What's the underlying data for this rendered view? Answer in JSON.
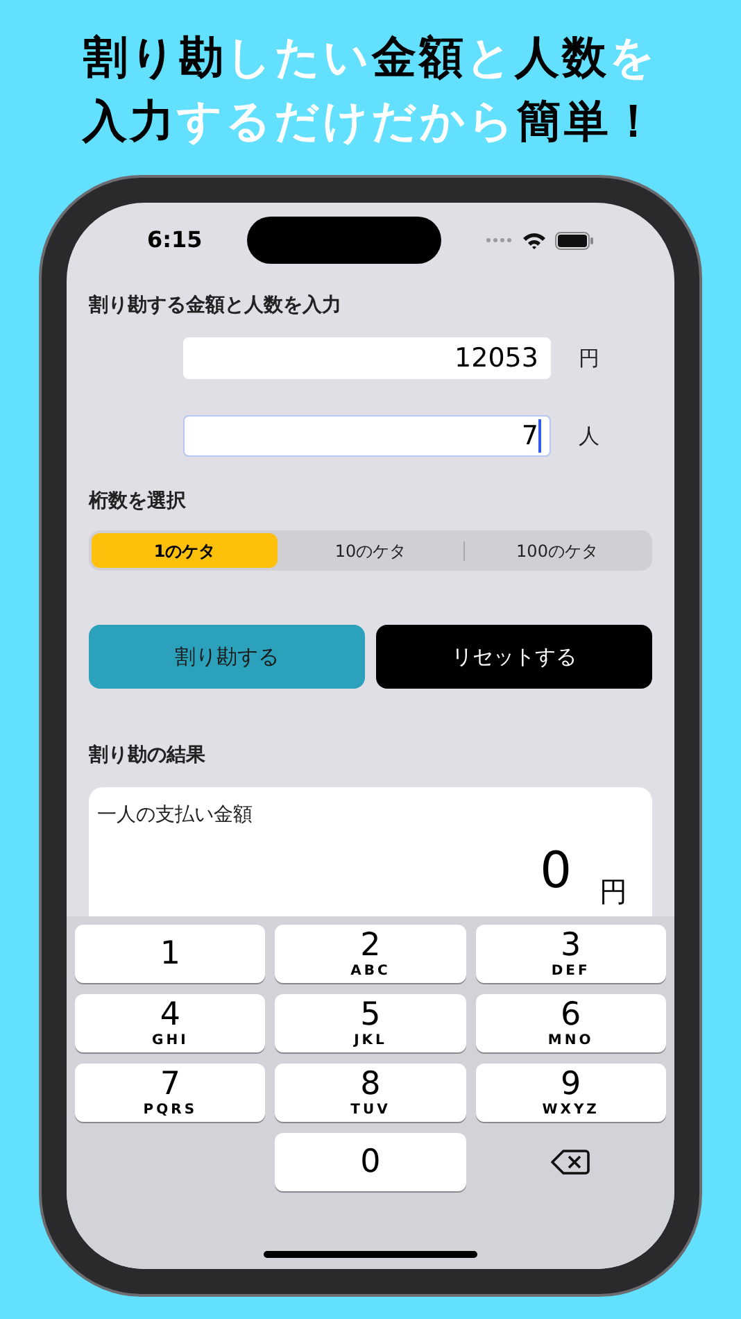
{
  "headline": [
    [
      {
        "text": "割り勘",
        "emphasis": true
      },
      {
        "text": "したい",
        "emphasis": false
      },
      {
        "text": "金額",
        "emphasis": true
      },
      {
        "text": "と",
        "emphasis": false
      },
      {
        "text": "人数",
        "emphasis": true
      },
      {
        "text": "を",
        "emphasis": false
      }
    ],
    [
      {
        "text": "入力",
        "emphasis": true
      },
      {
        "text": "するだけだから",
        "emphasis": false
      },
      {
        "text": "簡単！",
        "emphasis": true
      }
    ]
  ],
  "status_bar": {
    "time": "6:15"
  },
  "input_section": {
    "title": "割り勘する金額と人数を入力",
    "fields": [
      {
        "value": "12053",
        "unit": "円",
        "focused": false
      },
      {
        "value": "7",
        "unit": "人",
        "focused": true
      }
    ]
  },
  "digits_section": {
    "title": "桁数を選択",
    "segments": [
      {
        "label": "1のケタ",
        "selected": true
      },
      {
        "label": "10のケタ",
        "selected": false
      },
      {
        "label": "100のケタ",
        "selected": false
      }
    ]
  },
  "buttons": [
    {
      "label": "割り勘する",
      "kind": "primary"
    },
    {
      "label": "リセットする",
      "kind": "dark"
    }
  ],
  "result_section": {
    "title": "割り勘の結果",
    "card_label": "一人の支払い金額",
    "amount": "0",
    "unit": "円"
  },
  "keyboard": [
    {
      "kind": "digit",
      "digit": "1"
    },
    {
      "kind": "digit",
      "digit": "2",
      "letters": "ABC"
    },
    {
      "kind": "digit",
      "digit": "3",
      "letters": "DEF"
    },
    {
      "kind": "digit",
      "digit": "4",
      "letters": "GHI"
    },
    {
      "kind": "digit",
      "digit": "5",
      "letters": "JKL"
    },
    {
      "kind": "digit",
      "digit": "6",
      "letters": "MNO"
    },
    {
      "kind": "digit",
      "digit": "7",
      "letters": "PQRS"
    },
    {
      "kind": "digit",
      "digit": "8",
      "letters": "TUV"
    },
    {
      "kind": "digit",
      "digit": "9",
      "letters": "WXYZ"
    },
    {
      "kind": "blank"
    },
    {
      "kind": "digit",
      "digit": "0"
    },
    {
      "kind": "delete"
    }
  ]
}
